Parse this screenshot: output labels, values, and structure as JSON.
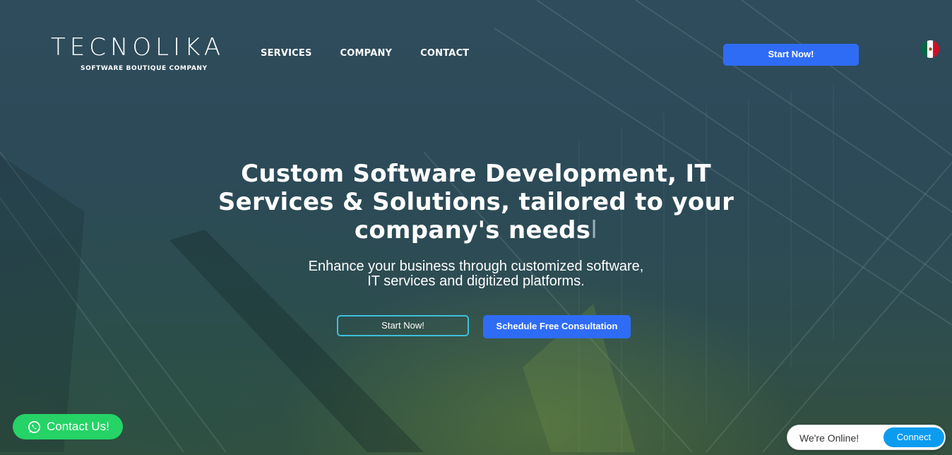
{
  "header": {
    "logo_text": "TECNOLIKA",
    "logo_tagline": "SOFTWARE BOUTIQUE COMPANY",
    "nav": [
      {
        "label": "SERVICES"
      },
      {
        "label": "COMPANY"
      },
      {
        "label": "CONTACT"
      }
    ],
    "cta_label": "Start Now!",
    "language_flag": "mexico-flag-icon"
  },
  "hero": {
    "headline_line1": "Custom Software Development, IT",
    "headline_line2": "Services & Solutions, tailored to your",
    "headline_line3": "company's needs",
    "typing_cursor": "l",
    "subheadline_line1": "Enhance your business through customized software,",
    "subheadline_line2": "IT services and digitized platforms.",
    "primary_outline_label": "Start Now!",
    "consultation_label": "Schedule Free Consultation"
  },
  "widgets": {
    "whatsapp_label": "Contact Us!",
    "whatsapp_icon": "whatsapp-icon",
    "chat_status": "We're Online!",
    "chat_button": "Connect"
  },
  "colors": {
    "accent_blue": "#2f6cf6",
    "outline_cyan": "#3cc0dc",
    "whatsapp_green": "#25d366",
    "chat_blue": "#0b9cf0"
  }
}
